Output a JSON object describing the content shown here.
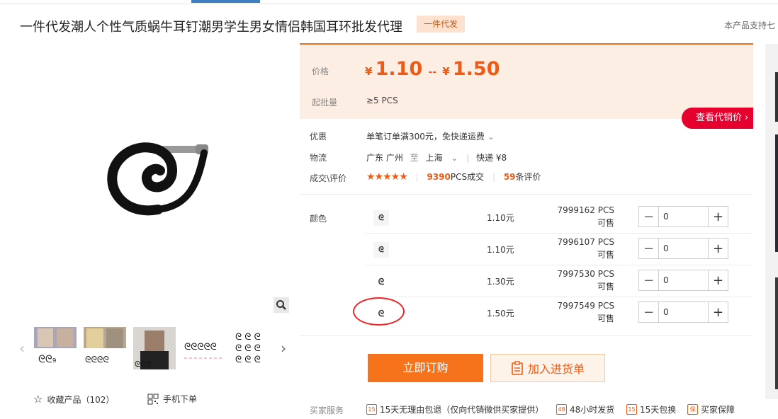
{
  "header": {
    "title": "一件代发潮人个性气质蜗牛耳钉潮男学生男女情侣韩国耳环批发代理",
    "tag": "一件代发",
    "support": "本产品支持七"
  },
  "gallery": {
    "favorite_label": "收藏产品（102）",
    "mobile_label": "手机下单"
  },
  "pricing": {
    "price_label": "价格",
    "currency": "¥",
    "price_low": "1.10",
    "separator": "--",
    "price_high": "1.50",
    "moq_label": "起批量",
    "moq_value": "≥5  PCS",
    "dealer_button": "查看代销价"
  },
  "info": {
    "promo_label": "优惠",
    "promo_value": "单笔订单满300元，免快递运费",
    "logistics_label": "物流",
    "from": "广东 广州",
    "to_word": "至",
    "to": "上海",
    "express": "快递 ¥8",
    "review_label": "成交\\评价",
    "stars": "★★★★★",
    "sold_count": "9390",
    "sold_unit": "PCS成交",
    "review_count": "59",
    "review_unit": "条评价"
  },
  "sku": {
    "color_label": "颜色",
    "rows": [
      {
        "price": "1.10元",
        "stock": "7999162 PCS可售",
        "qty": "0"
      },
      {
        "price": "1.10元",
        "stock": "7996107 PCS可售",
        "qty": "0"
      },
      {
        "price": "1.30元",
        "stock": "7997530 PCS可售",
        "qty": "0"
      },
      {
        "price": "1.50元",
        "stock": "7997549 PCS可售",
        "qty": "0"
      }
    ]
  },
  "actions": {
    "buy_now": "立即订购",
    "add_to_cart": "加入进货单"
  },
  "services": {
    "label": "买家服务",
    "items": [
      {
        "icon": "15",
        "text": "15天无理由包退（仅向代销微供买家提供）"
      },
      {
        "icon": "48",
        "text": "48小时发货"
      },
      {
        "icon": "15",
        "text": "15天包换"
      },
      {
        "icon": "保",
        "text": "买家保障"
      }
    ]
  },
  "colors": {
    "accent": "#f05a14",
    "buy": "#f6731c",
    "dealer": "#e5002d"
  }
}
